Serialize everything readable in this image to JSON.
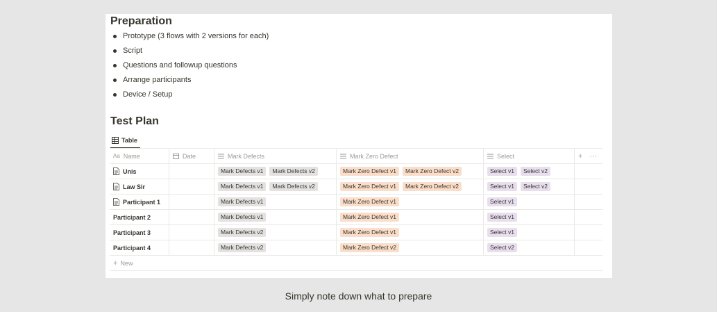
{
  "preparation": {
    "title": "Preparation",
    "items": [
      "Prototype (3 flows with 2 versions for each)",
      "Script",
      "Questions and followup questions",
      "Arrange participants",
      "Device / Setup"
    ]
  },
  "test_plan": {
    "title": "Test Plan",
    "view_tab": "Table",
    "columns": [
      "Name",
      "Date",
      "Mark Defects",
      "Mark Zero Defect",
      "Select"
    ],
    "add_label": "+",
    "more_label": "···",
    "rows": [
      {
        "name": "Unis",
        "has_page_icon": true,
        "date": "",
        "mark_defects": [
          "Mark Defects v1",
          "Mark Defects v2"
        ],
        "mark_zero_defect": [
          "Mark Zero Defect v1",
          "Mark Zero Defect v2"
        ],
        "select": [
          "Select v1",
          "Select v2"
        ]
      },
      {
        "name": "Law Sir",
        "has_page_icon": true,
        "date": "",
        "mark_defects": [
          "Mark Defects v1",
          "Mark Defects v2"
        ],
        "mark_zero_defect": [
          "Mark Zero Defect v1",
          "Mark Zero Defect v2"
        ],
        "select": [
          "Select v1",
          "Select v2"
        ]
      },
      {
        "name": "Participant 1",
        "has_page_icon": true,
        "date": "",
        "mark_defects": [
          "Mark Defects v1"
        ],
        "mark_zero_defect": [
          "Mark Zero Defect v1"
        ],
        "select": [
          "Select v1"
        ]
      },
      {
        "name": "Participant 2",
        "has_page_icon": false,
        "date": "",
        "mark_defects": [
          "Mark Defects v1"
        ],
        "mark_zero_defect": [
          "Mark Zero Defect v1"
        ],
        "select": [
          "Select v1"
        ]
      },
      {
        "name": "Participant 3",
        "has_page_icon": false,
        "date": "",
        "mark_defects": [
          "Mark Defects v2"
        ],
        "mark_zero_defect": [
          "Mark Zero Defect v1"
        ],
        "select": [
          "Select v1"
        ]
      },
      {
        "name": "Participant 4",
        "has_page_icon": false,
        "date": "",
        "mark_defects": [
          "Mark Defects v2"
        ],
        "mark_zero_defect": [
          "Mark Zero Defect v2"
        ],
        "select": [
          "Select v2"
        ]
      }
    ],
    "new_row_label": "New",
    "tag_colors": {
      "mark_defects": "#e3e2e0",
      "mark_zero_defect": "#fadec9",
      "select": "#e8deee"
    }
  },
  "caption": "Simply note down what to prepare"
}
